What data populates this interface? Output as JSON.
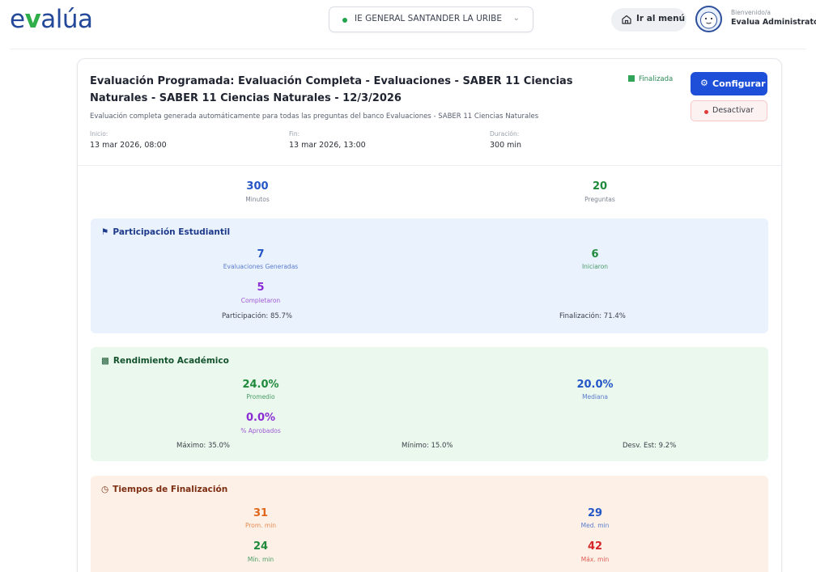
{
  "brand": {
    "logo_pre": "e",
    "logo_v": "v",
    "logo_post": "alúa"
  },
  "institution": {
    "selected": "IE GENERAL SANTANDER LA URIBE"
  },
  "nav": {
    "menu_label": "Ir al menú"
  },
  "user": {
    "greeting": "Bienvenido/a",
    "name": "Evalua Administrator"
  },
  "evaluation": {
    "title": "Evaluación Programada: Evaluación Completa - Evaluaciones - SABER 11 Ciencias Naturales - SABER 11 Ciencias Naturales - 12/3/2026",
    "status": "Finalizada",
    "configure_label": "Configurar",
    "deactivate_label": "Desactivar",
    "description": "Evaluación completa generada automáticamente para todas las preguntas del banco Evaluaciones - SABER 11 Ciencias Naturales",
    "start_label": "Inicio:",
    "start_value": "13 mar 2026, 08:00",
    "end_label": "Fin:",
    "end_value": "13 mar 2026, 13:00",
    "duration_label": "Duración:",
    "duration_value": "300 min"
  },
  "summary": {
    "minutes_value": "300",
    "minutes_label": "Minutos",
    "questions_value": "20",
    "questions_label": "Preguntas"
  },
  "participation": {
    "title": "Participación Estudiantil",
    "generated_value": "7",
    "generated_label": "Evaluaciones Generadas",
    "started_value": "6",
    "started_label": "Iniciaron",
    "completed_value": "5",
    "completed_label": "Completaron",
    "participation_rate": "Participación: 85.7%",
    "completion_rate": "Finalización: 71.4%"
  },
  "performance": {
    "title": "Rendimiento Académico",
    "average_value": "24.0%",
    "average_label": "Promedio",
    "median_value": "20.0%",
    "median_label": "Mediana",
    "approved_value": "0.0%",
    "approved_label": "% Aprobados",
    "max": "Máximo: 35.0%",
    "min": "Mínimo: 15.0%",
    "std": "Desv. Est: 9.2%"
  },
  "times": {
    "title": "Tiempos de Finalización",
    "avg_value": "31",
    "avg_label": "Prom. min",
    "median_value": "29",
    "median_label": "Med. min",
    "min_value": "24",
    "min_label": "Mín. min",
    "max_value": "42",
    "max_label": "Máx. min"
  },
  "colors": {
    "primary": "#1d4fd8",
    "brand_blue": "#24489a",
    "brand_green": "#2fae4a",
    "participation_bg": "#eaf2fd",
    "performance_bg": "#eaf8ee",
    "times_bg": "#fdf1e7"
  },
  "icons": {
    "institution": "status-dot-icon",
    "menu": "home-icon",
    "configure": "gear-icon",
    "deactivate": "red-dot-icon",
    "status": "check-square-icon",
    "participation": "users-icon",
    "performance": "bar-chart-icon",
    "times": "clock-icon"
  }
}
